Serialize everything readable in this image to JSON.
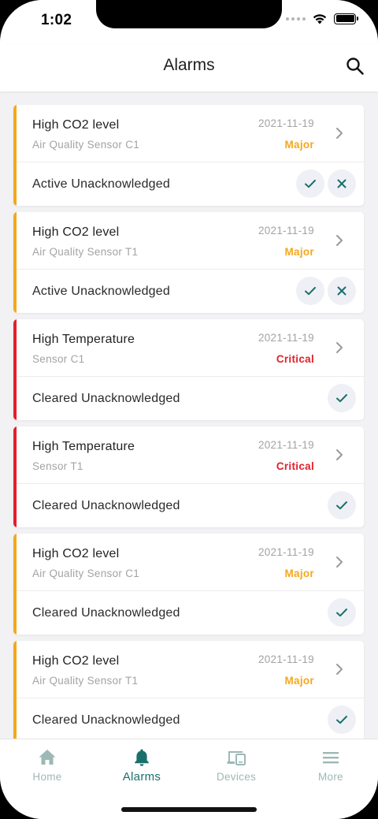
{
  "status_bar": {
    "time": "1:02"
  },
  "header": {
    "title": "Alarms",
    "search_icon": "search-icon"
  },
  "colors": {
    "major": "#f5a81c",
    "critical": "#e3202a",
    "accent": "#1a6f6b",
    "tab_inactive": "#9db8b6"
  },
  "alarms": [
    {
      "title": "High CO2 level",
      "origin": "Air Quality Sensor C1",
      "date": "2021-11-19",
      "severity": "Major",
      "status": "Active Unacknowledged"
    },
    {
      "title": "High CO2 level",
      "origin": "Air Quality Sensor T1",
      "date": "2021-11-19",
      "severity": "Major",
      "status": "Active Unacknowledged"
    },
    {
      "title": "High Temperature",
      "origin": "Sensor C1",
      "date": "2021-11-19",
      "severity": "Critical",
      "status": "Cleared Unacknowledged"
    },
    {
      "title": "High Temperature",
      "origin": "Sensor T1",
      "date": "2021-11-19",
      "severity": "Critical",
      "status": "Cleared Unacknowledged"
    },
    {
      "title": "High CO2 level",
      "origin": "Air Quality Sensor C1",
      "date": "2021-11-19",
      "severity": "Major",
      "status": "Cleared Unacknowledged"
    },
    {
      "title": "High CO2 level",
      "origin": "Air Quality Sensor T1",
      "date": "2021-11-19",
      "severity": "Major",
      "status": "Cleared Unacknowledged"
    }
  ],
  "tabs": [
    {
      "label": "Home",
      "icon": "home-icon",
      "active": false
    },
    {
      "label": "Alarms",
      "icon": "bell-icon",
      "active": true
    },
    {
      "label": "Devices",
      "icon": "devices-icon",
      "active": false
    },
    {
      "label": "More",
      "icon": "menu-icon",
      "active": false
    }
  ]
}
